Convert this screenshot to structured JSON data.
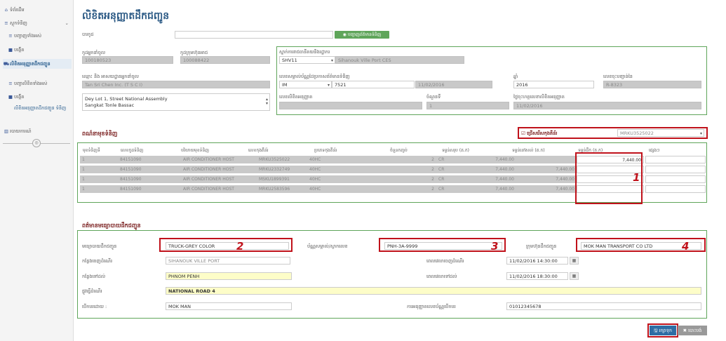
{
  "sidebar": {
    "items": [
      {
        "icon": "⌂",
        "label": "ទំព័រដើម"
      },
      {
        "icon": "≡",
        "label": "ស្តុកទំនិញ"
      },
      {
        "icon": "≡",
        "label": "បញ្ជាញទាំងអស់"
      },
      {
        "icon": "■",
        "label": "បង្កើត"
      },
      {
        "icon": "⛟",
        "label": "លិខិតអនុញ្ញាតដឹកជញ្ជូន"
      },
      {
        "icon": "≡",
        "label": "បញ្ជាលិខិតទាំងអស់"
      },
      {
        "icon": "■",
        "label": "បង្កើត"
      },
      {
        "icon": "",
        "label": "លិខិតអនុញ្ញាតដឹកជញ្ជូន ទំនិញ"
      },
      {
        "icon": "▥",
        "label": "របាយការណ៍"
      }
    ],
    "circle": "◎"
  },
  "page_title": "លិខិតអនុញ្ញាតដឹកជញ្ជូន",
  "top": {
    "code_label": "បារកូដ",
    "code_value": "",
    "code_button": "◉ បញ្ជាញព័ត៌មានទំនិញ",
    "importer_code_label": "កូដអ្នកនាំចូល",
    "importer_code": "100180523",
    "owner_code_label": "កូដក្រុមហ៊ុនអាជ",
    "owner_code": "100088422",
    "importer_name_label": "ឈ្មោះ និង អាសយដ្ឋានអ្នកនាំចូល",
    "importer_name": "Tan Sri Chen Inc. (T S C I)",
    "address_line1": "Dey Lot 1, Street National Assembly",
    "address_line2": "Sangkat Tonle Bassac",
    "office_label": "ស្នាក់ការរាជធានីគយនិងរដ្ឋាករ",
    "office_code": "SHV11",
    "office_name": "Sihanouk Ville Port CES",
    "decl_label": "លេខសម្គាល់ប័ណ្ណដៃប្រកាសព័ត៌មានទំនិញ",
    "decl_type": "IM",
    "decl_no": "7521",
    "decl_date": "11/02/2016",
    "year_label": "ឆ្នាំ",
    "year": "2016",
    "reg_label": "លេខចុះបញ្ជាន់នៃ",
    "reg": "R-8323",
    "permit_no_label": "លេខលិខិតអនុញ្ញាត",
    "permit_no": "",
    "seq_label": "ចំណួនទី",
    "seq": "1",
    "permit_date_label": "ថ្ងៃចុះហត្ថលេខាលិខិតអនុញ្ញាត",
    "permit_date": "11/02/2016"
  },
  "goods": {
    "title": "ពណ៌នាមុខទំនិញ",
    "select_all_label": "ជ្រើសរើសកុងតឺន័រ",
    "container_select": "MRKU3525022",
    "headers": [
      "មុខទំនិញទី",
      "លេខកូដទំនិញ",
      "បរិយាយមុខទំនិញ",
      "លេខកុងតឺន័រ",
      "ប្រភេទកុងតឺន័រ",
      "ចំនួនកញ្ចប់",
      "ទម្ងន់សរុប (គ.ក)",
      "ទម្ងន់នៅសល់ (គ.ក)",
      "ទម្ងន់ដឹក (គ.ក)",
      "ផ្សេងៗ"
    ],
    "rows": [
      {
        "no": "1",
        "hs": "84151090",
        "desc": "AIR CONDITIONER HOST",
        "container": "MRKU3525022",
        "type": "40HC",
        "pkgs": "2",
        "unit": "CR",
        "gross": "7,440.00",
        "remaining": "",
        "ship": "7,440.00",
        "other": ""
      },
      {
        "no": "1",
        "hs": "84151090",
        "desc": "AIR CONDITIONER HOST",
        "container": "MRKU2332749",
        "type": "40HC",
        "pkgs": "2",
        "unit": "CR",
        "gross": "7,440.00",
        "remaining": "7,440.00",
        "ship": "",
        "other": ""
      },
      {
        "no": "1",
        "hs": "84151090",
        "desc": "AIR CONDITIONER HOST",
        "container": "MSKU1899391",
        "type": "40HC",
        "pkgs": "2",
        "unit": "CR",
        "gross": "7,440.00",
        "remaining": "7,440.00",
        "ship": "",
        "other": ""
      },
      {
        "no": "1",
        "hs": "84151090",
        "desc": "AIR CONDITIONER HOST",
        "container": "MRKU2583596",
        "type": "40HC",
        "pkgs": "2",
        "unit": "CR",
        "gross": "7,440.00",
        "remaining": "7,440.00",
        "ship": "",
        "other": ""
      }
    ]
  },
  "transport": {
    "title": "ពត៌មានមធ្យោបាយដឹកជញ្ជូន",
    "vehicle_label": "មធ្យោបាយដឹកជញ្ជូន",
    "vehicle": "TRUCK-GREY COLOR",
    "plate_label": "ប័ណ្ណសម្គាល់/ស្លាកលេខ",
    "plate": "PNH-3A-9999",
    "company_label": "ក្រុមហ៊ុនដឹកជញ្ជូន",
    "company": "MOK MAN TRANSPORT CO LTD",
    "from_label": "កន្លែងចេញដំណើរ",
    "from": "SIHANOUK VILLE PORT",
    "depart_label": "ពេលវេលាចេញដំណើរ",
    "depart": "11/02/2016 14:30:00",
    "to_label": "កន្លែងទៅដល់",
    "to": "PHNOM PENH",
    "arrive_label": "ពេលវេលាទៅដល់",
    "arrive": "11/02/2016 18:30:00",
    "route_label": "ផ្លូវធ្វើដំណើរ",
    "route": "NATIONAL ROAD 4",
    "driver_label": "បើកបរដោយ :",
    "driver": "MOK MAN",
    "license_label": "ការអនុញ្ញាតលេខប័ណ្ណបើកបរ",
    "license": "01012345678"
  },
  "annotations": [
    "1",
    "2",
    "3",
    "4"
  ],
  "buttons": {
    "save": "🖫 រក្សាទុក",
    "cancel": "✖ បោះបង់"
  }
}
